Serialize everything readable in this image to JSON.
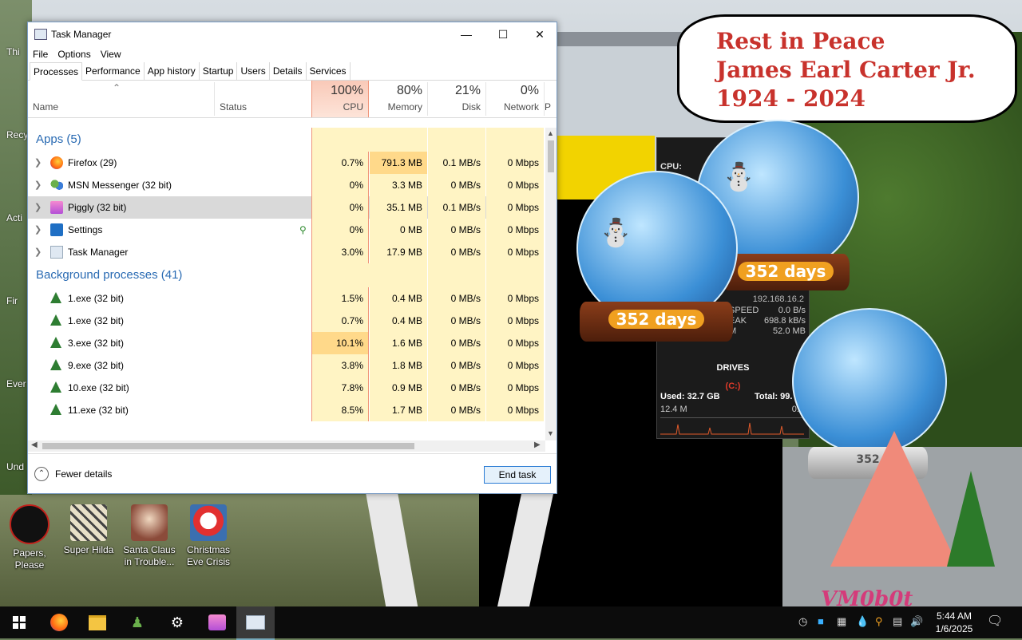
{
  "desktop": {
    "bubble_lines": [
      "Rest in Peace",
      "James Earl Carter Jr.",
      "1924 - 2024"
    ],
    "countdown": "352 days",
    "countdown_small": "352",
    "signature": "VM0b0t",
    "gadget": {
      "cpu_label": "CPU:",
      "ip": "192.168.16.2",
      "speed_rows": [
        {
          "label": "SPEED",
          "value": "0.0 B/s"
        },
        {
          "label": "EAK",
          "value": "698.8 kB/s"
        },
        {
          "label": "M",
          "value": "52.0 MB"
        }
      ],
      "drives_title": "DRIVES",
      "drive": "(C:)",
      "used": "Used: 32.7 GB",
      "total": "Total: 99.",
      "rate_left": "12.4 M",
      "rate_right": "0.0"
    },
    "edge_labels": [
      "Thi",
      "Recy",
      "Acti",
      "Fir",
      "Ever",
      "Und"
    ],
    "icons": [
      {
        "label": "Papers, Please",
        "color": "#1a1a1a",
        "accent": "#c0201a"
      },
      {
        "label": "Super Hilda",
        "color": "#e8e0c8",
        "accent": "#333"
      },
      {
        "label": "Santa Claus in Trouble...",
        "color": "#8b4b3a",
        "accent": "#e8d0b0"
      },
      {
        "label": "Christmas Eve Crisis",
        "color": "#3b6fb0",
        "accent": "#e23030"
      }
    ]
  },
  "window": {
    "title": "Task Manager",
    "menu": [
      "File",
      "Options",
      "View"
    ],
    "tabs": [
      "Processes",
      "Performance",
      "App history",
      "Startup",
      "Users",
      "Details",
      "Services"
    ],
    "active_tab": "Processes",
    "columns": {
      "name": "Name",
      "status": "Status",
      "cpu_pct": "100%",
      "cpu": "CPU",
      "mem_pct": "80%",
      "mem": "Memory",
      "disk_pct": "21%",
      "disk": "Disk",
      "net_pct": "0%",
      "net": "Network",
      "more": "P"
    },
    "groups": [
      {
        "title": "Apps (5)",
        "rows": [
          {
            "name": "Firefox (29)",
            "cpu": "0.7%",
            "mem": "791.3 MB",
            "disk": "0.1 MB/s",
            "net": "0 Mbps",
            "icon": "firefox-icon",
            "expand": true,
            "mem_hi": true
          },
          {
            "name": "MSN Messenger (32 bit)",
            "cpu": "0%",
            "mem": "3.3 MB",
            "disk": "0 MB/s",
            "net": "0 Mbps",
            "icon": "msn-messenger-icon",
            "expand": true
          },
          {
            "name": "Piggly (32 bit)",
            "cpu": "0%",
            "mem": "35.1 MB",
            "disk": "0.1 MB/s",
            "net": "0 Mbps",
            "icon": "piggly-icon",
            "expand": true,
            "selected": true
          },
          {
            "name": "Settings",
            "cpu": "0%",
            "mem": "0 MB",
            "disk": "0 MB/s",
            "net": "0 Mbps",
            "icon": "settings-gear-icon",
            "expand": true,
            "suspended": true
          },
          {
            "name": "Task Manager",
            "cpu": "3.0%",
            "mem": "17.9 MB",
            "disk": "0 MB/s",
            "net": "0 Mbps",
            "icon": "task-manager-icon",
            "expand": true
          }
        ]
      },
      {
        "title": "Background processes (41)",
        "rows": [
          {
            "name": "1.exe (32 bit)",
            "cpu": "1.5%",
            "mem": "0.4 MB",
            "disk": "0 MB/s",
            "net": "0 Mbps",
            "icon": "tree-icon"
          },
          {
            "name": "1.exe (32 bit)",
            "cpu": "0.7%",
            "mem": "0.4 MB",
            "disk": "0 MB/s",
            "net": "0 Mbps",
            "icon": "tree-icon"
          },
          {
            "name": "3.exe (32 bit)",
            "cpu": "10.1%",
            "mem": "1.6 MB",
            "disk": "0 MB/s",
            "net": "0 Mbps",
            "icon": "tree-icon",
            "cpu_hi": true
          },
          {
            "name": "9.exe (32 bit)",
            "cpu": "3.8%",
            "mem": "1.8 MB",
            "disk": "0 MB/s",
            "net": "0 Mbps",
            "icon": "tree-icon"
          },
          {
            "name": "10.exe (32 bit)",
            "cpu": "7.8%",
            "mem": "0.9 MB",
            "disk": "0 MB/s",
            "net": "0 Mbps",
            "icon": "tree-icon"
          },
          {
            "name": "11.exe (32 bit)",
            "cpu": "8.5%",
            "mem": "1.7 MB",
            "disk": "0 MB/s",
            "net": "0 Mbps",
            "icon": "tree-icon"
          }
        ]
      }
    ],
    "fewer_details": "Fewer details",
    "end_task": "End task"
  },
  "taskbar": {
    "items": [
      "start-icon",
      "firefox-icon",
      "file-explorer-icon",
      "msn-messenger-icon",
      "settings-gear-icon",
      "piggly-icon",
      "task-manager-icon"
    ],
    "time": "5:44 AM",
    "date": "1/6/2025"
  },
  "colors": {
    "accent": "#2a6bb3",
    "cpu_header": "#f9c9b8",
    "cell": "#fff4c4",
    "cell_hi": "#ffd98a"
  }
}
